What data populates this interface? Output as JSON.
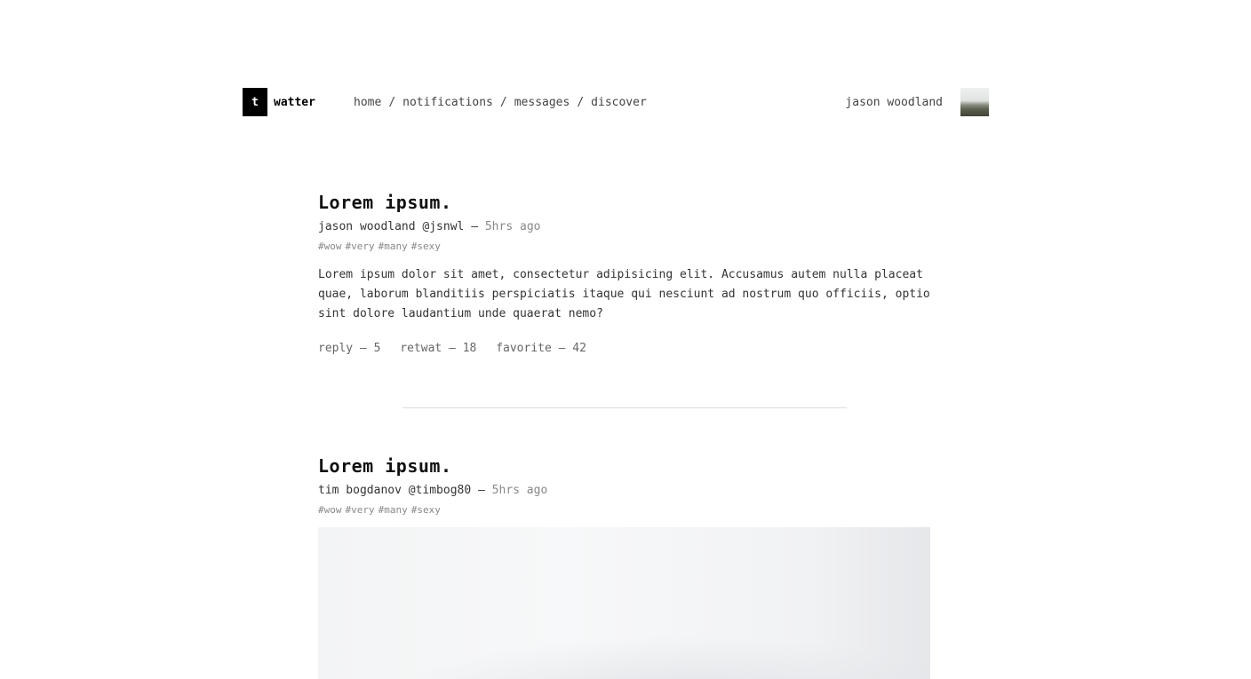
{
  "header": {
    "logo_letter": "t",
    "logo_text": "watter",
    "nav": [
      "home",
      "notifications",
      "messages",
      "discover"
    ],
    "nav_separator": "/",
    "user_name": "jason woodland"
  },
  "posts": [
    {
      "title": "Lorem ipsum.",
      "author": "jason woodland @jsnwl",
      "dash": "–",
      "time": "5hrs ago",
      "tags": [
        "#wow",
        "#very",
        "#many",
        "#sexy"
      ],
      "body": "Lorem ipsum dolor sit amet, consectetur adipisicing elit. Accusamus autem nulla placeat quae, laborum blanditiis perspiciatis itaque qui nesciunt ad nostrum quo officiis, optio sint dolore laudantium unde quaerat nemo?",
      "actions": [
        "reply – 5",
        "retwat – 18",
        "favorite – 42"
      ]
    },
    {
      "title": "Lorem ipsum.",
      "author": "tim bogdanov @timbog80",
      "dash": "–",
      "time": "5hrs ago",
      "tags": [
        "#wow",
        "#very",
        "#many",
        "#sexy"
      ]
    }
  ]
}
